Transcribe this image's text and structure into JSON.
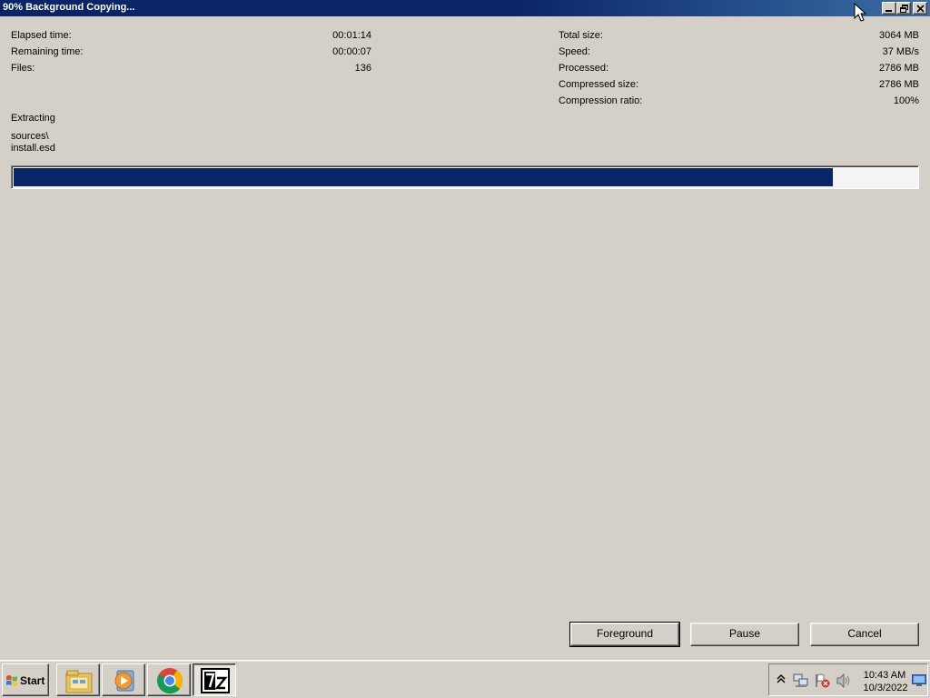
{
  "window": {
    "title": "90% Background Copying..."
  },
  "stats_left": [
    {
      "label": "Elapsed time:",
      "value": "00:01:14"
    },
    {
      "label": "Remaining time:",
      "value": "00:00:07"
    },
    {
      "label": "Files:",
      "value": "136"
    }
  ],
  "stats_right": [
    {
      "label": "Total size:",
      "value": "3064 MB"
    },
    {
      "label": "Speed:",
      "value": "37 MB/s"
    },
    {
      "label": "Processed:",
      "value": "2786 MB"
    },
    {
      "label": "Compressed size:",
      "value": "2786 MB"
    },
    {
      "label": "Compression ratio:",
      "value": "100%"
    }
  ],
  "operation": "Extracting",
  "current_file": {
    "line1": "sources\\",
    "line2": "install.esd"
  },
  "progress": {
    "fraction": 0.907,
    "fill_color": "#0a246a"
  },
  "buttons": {
    "foreground": "Foreground",
    "pause": "Pause",
    "cancel": "Cancel"
  },
  "taskbar": {
    "start_label": "Start",
    "apps": [
      "folder-icon",
      "media-player-icon",
      "chrome-icon",
      "7zip-icon"
    ],
    "clock_time": "10:43 AM",
    "clock_date": "10/3/2022"
  },
  "colors": {
    "title_bar": "#0a246a",
    "face": "#d4d0c8"
  }
}
